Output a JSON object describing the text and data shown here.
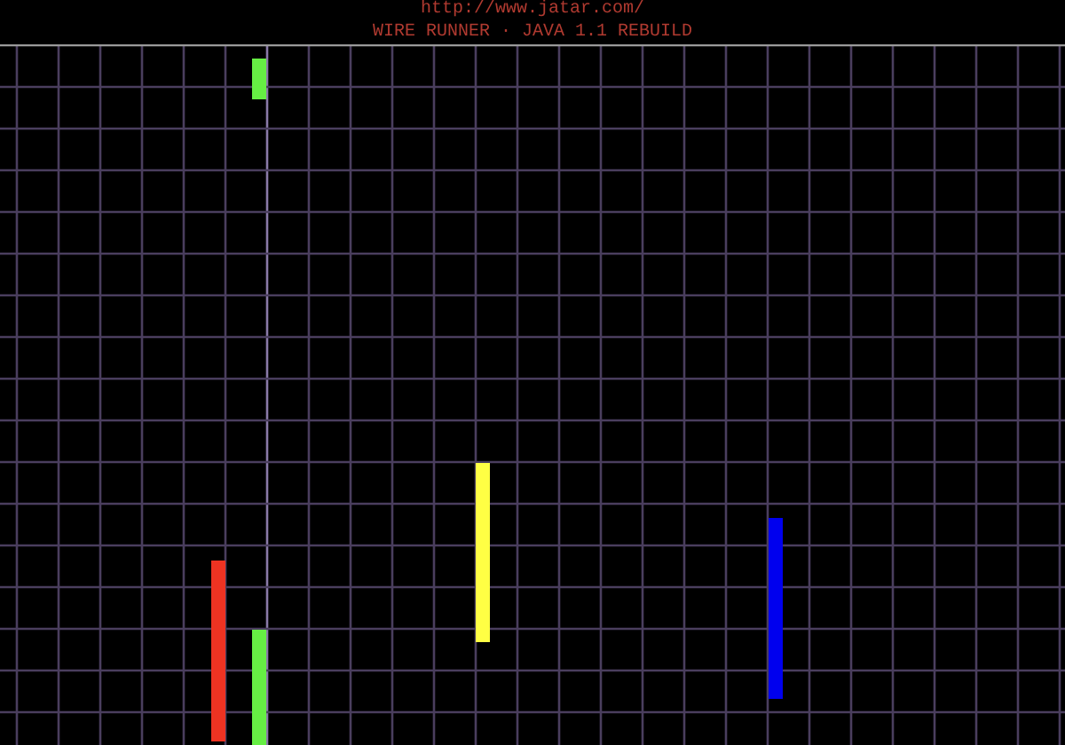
{
  "header": {
    "url": "http://www.jatar.com/",
    "title": "WIRE RUNNER · JAVA 1.1 REBUILD"
  },
  "wires": [
    {
      "color": "#66ee44"
    },
    {
      "color": "#ee3322"
    },
    {
      "color": "#66ee44"
    },
    {
      "color": "#ffff44"
    },
    {
      "color": "#0000ee"
    }
  ]
}
